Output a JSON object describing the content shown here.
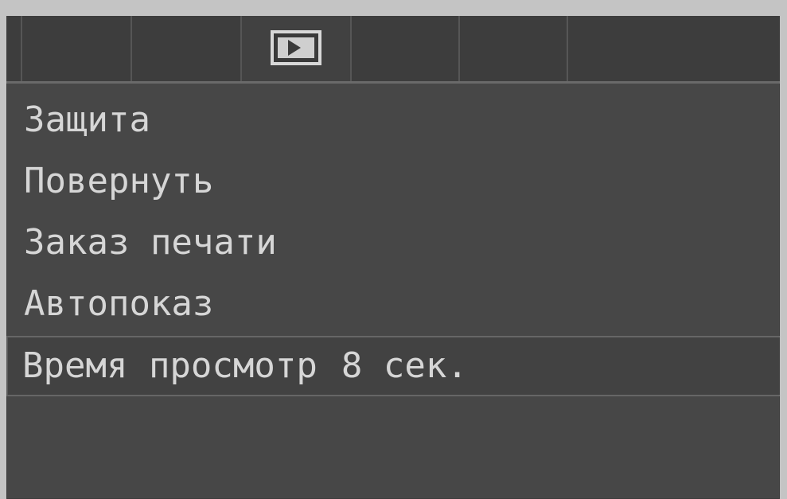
{
  "tabs": [
    {
      "id": "tab-1",
      "icon": ""
    },
    {
      "id": "tab-2",
      "icon": ""
    },
    {
      "id": "tab-3",
      "icon": ""
    },
    {
      "id": "tab-playback",
      "icon": "play-icon",
      "active": true
    },
    {
      "id": "tab-5",
      "icon": ""
    },
    {
      "id": "tab-6",
      "icon": ""
    },
    {
      "id": "tab-7",
      "icon": ""
    }
  ],
  "menu": {
    "items": [
      {
        "label": "Защита"
      },
      {
        "label": "Повернуть"
      },
      {
        "label": "Заказ печати"
      },
      {
        "label": "Автопоказ"
      },
      {
        "label": "Время просмотр",
        "value": "8 сек.",
        "selected": true
      }
    ]
  },
  "colors": {
    "screen_bg": "#474747",
    "tabbar_bg": "#3d3d3d",
    "text": "#d6d6d6",
    "highlight_border": "#666666"
  }
}
